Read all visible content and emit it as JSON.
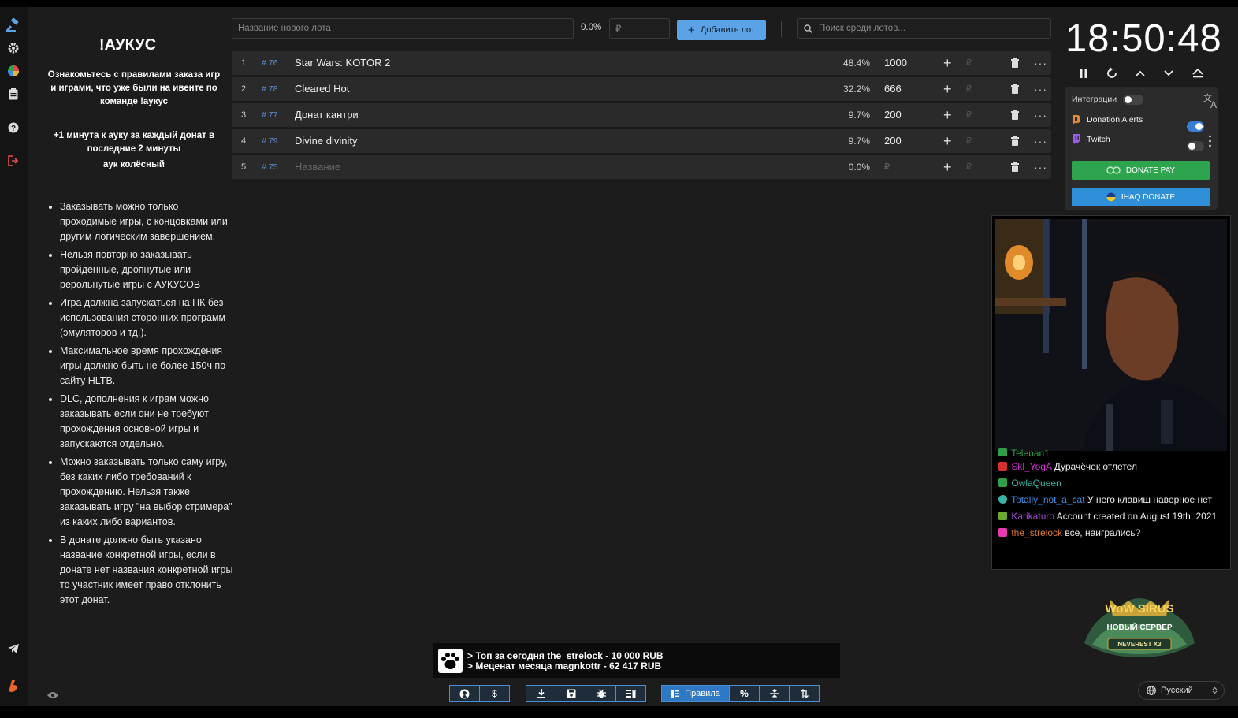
{
  "rules": {
    "title": "!АУКУС",
    "intro": "Ознакомьтесь с правилами заказа игр и играми, что уже были на ивенте по команде !аукус",
    "bonus": "+1 минута к ауку за каждый донат в последние 2 минуты",
    "wheel": "аук колёсный",
    "items": [
      "Заказывать можно только проходимые игры, с концовками или другим логическим завершением.",
      "Нельзя повторно заказывать пройденные, дропнутые или рерольнутые игры с АУКУСОВ",
      "Игра должна запускаться на ПК без использования сторонних программ (эмуляторов и тд.).",
      "Максимальное время прохождения игры должно быть не более 150ч по сайту HLTB.",
      "DLC, дополнения к играм можно заказывать если они не требуют прохождения основной игры и запускаются отдельно.",
      "Можно заказывать только саму игру, без каких либо требований к прохождению. Нельзя также заказывать игру \"на выбор стримера\" из каких либо вариантов.",
      "В донате должно быть указано название конкретной игры, если в донате нет названия конкретной игры то участник имеет право отклонить этот донат."
    ]
  },
  "new_lot": {
    "name_placeholder": "Название нового лота",
    "percent": "0.0%",
    "amount_placeholder": "₽",
    "add_label": "Добавить лот",
    "search_placeholder": "Поиск среди лотов..."
  },
  "lots": [
    {
      "num": "1",
      "id": "# 76",
      "name": "Star Wars: KOTOR 2",
      "percent": "48.4%",
      "amount": "1000",
      "currency": "₽"
    },
    {
      "num": "2",
      "id": "# 78",
      "name": "Cleared Hot",
      "percent": "32.2%",
      "amount": "666",
      "currency": "₽"
    },
    {
      "num": "3",
      "id": "# 77",
      "name": "Донат кантри",
      "percent": "9.7%",
      "amount": "200",
      "currency": "₽"
    },
    {
      "num": "4",
      "id": "# 79",
      "name": "Divine divinity",
      "percent": "9.7%",
      "amount": "200",
      "currency": "₽"
    },
    {
      "num": "5",
      "id": "# 75",
      "name": "Название",
      "percent": "0.0%",
      "amount": "₽",
      "currency": "₽"
    }
  ],
  "timer": {
    "time": "18:50:48"
  },
  "integrations": {
    "label": "Интеграции",
    "services": [
      "Donation Alerts",
      "Twitch"
    ],
    "donatepay_label": "DONATE PAY",
    "ihaq_label": "IHAQ DONATE"
  },
  "chat": [
    {
      "user": "Telepan1",
      "color": "#2e9e4a",
      "text": ""
    },
    {
      "user": "Skl_YogA",
      "color": "#d22fd6",
      "text": "Дурачёчек отлетел"
    },
    {
      "user": "OwlaQueen",
      "color": "#39b3a6",
      "text": ""
    },
    {
      "user": "Totally_not_a_cat",
      "color": "#3d8ee6",
      "text": "У него клавиш наверное нет"
    },
    {
      "user": "Karikaturo",
      "color": "#a54ad8",
      "text": "Account created on August 19th, 2021"
    },
    {
      "user": "the_strelock",
      "color": "#e07a2e",
      "text": "все, наигрались?"
    }
  ],
  "banner": {
    "line1": "> Топ за сегодня the_strelock - 10 000 RUB",
    "line2": "> Меценат месяца magnkottr - 62 417 RUB"
  },
  "toolbar": {
    "rules_label": "Правила",
    "percent_label": "%"
  },
  "language": {
    "selected": "Русский"
  },
  "promo": {
    "brand": "WoW SIRUS",
    "tagline": "НОВЫЙ СЕРВЕР",
    "server": "NEVEREST X3"
  },
  "colors": {
    "accent": "#5ba3e6",
    "donatepay": "#2fa44f",
    "ihaq": "#2f8fd8"
  }
}
